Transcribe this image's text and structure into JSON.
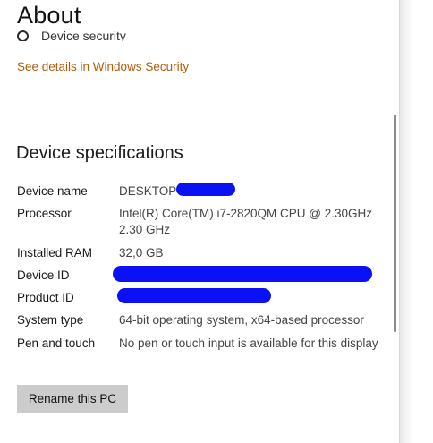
{
  "page": {
    "title": "About"
  },
  "security": {
    "clipped_text": "Device security",
    "link_label": "See details in Windows Security"
  },
  "specs": {
    "heading": "Device specifications",
    "rows": [
      {
        "label": "Device name",
        "value": "DESKTOP-"
      },
      {
        "label": "Processor",
        "value": "Intel(R) Core(TM) i7-2820QM CPU @ 2.30GHz 2.30 GHz"
      },
      {
        "label": "Installed RAM",
        "value": "32,0 GB"
      },
      {
        "label": "Device ID",
        "value": ""
      },
      {
        "label": "Product ID",
        "value": ""
      },
      {
        "label": "System type",
        "value": "64-bit operating system, x64-based processor"
      },
      {
        "label": "Pen and touch",
        "value": "No pen or touch input is available for this display"
      }
    ]
  },
  "actions": {
    "rename_label": "Rename this PC"
  },
  "colors": {
    "link": "#b35c0c",
    "redaction": "#0a12f5",
    "button_bg": "#cccccc"
  }
}
